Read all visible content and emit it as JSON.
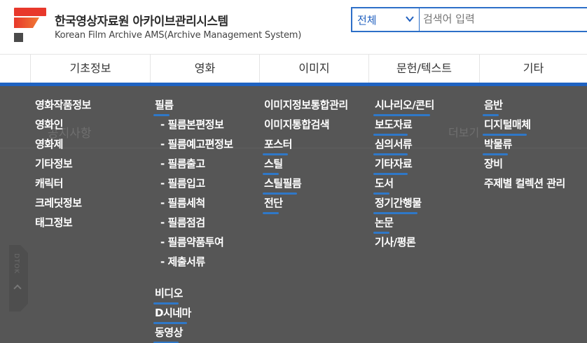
{
  "brand": {
    "title_ko": "한국영상자료원 아카이브관리시스템",
    "title_en": "Korean Film Archive AMS(Archive Management System)"
  },
  "search": {
    "scope_selected": "전체",
    "placeholder": "검색어 입력"
  },
  "nav": {
    "items": [
      {
        "label": "기초정보"
      },
      {
        "label": "영화"
      },
      {
        "label": "이미지"
      },
      {
        "label": "문헌/텍스트"
      },
      {
        "label": "기타"
      }
    ]
  },
  "background": {
    "notice": "공지사항",
    "more": "더보기",
    "side_tab": "DTOK"
  },
  "menu": {
    "basic": [
      "영화작품정보",
      "영화인",
      "영화제",
      "기타정보",
      "캐릭터",
      "크레딧정보",
      "태그정보"
    ],
    "film": {
      "film_title": "필름",
      "film_subs": [
        "- 필름본편정보",
        "- 필름예고편정보",
        "- 필름출고",
        "- 필름입고",
        "- 필름세척",
        "- 필름점검",
        "- 필름약품투여",
        "- 제출서류"
      ],
      "video": "비디오",
      "dcinema": "D시네마",
      "motion": "동영상"
    },
    "image": [
      "이미지정보통합관리",
      "이미지통합검색",
      "포스터",
      "스틸",
      "스틸필름",
      "전단"
    ],
    "text": [
      "시나리오/콘티",
      "보도자료",
      "심의서류",
      "기타자료",
      "도서",
      "정기간행물",
      "논문",
      "기사/평론"
    ],
    "etc": [
      "음반",
      "디지털매체",
      "박물류",
      "장비",
      "주제별 컬렉션 관리"
    ]
  },
  "colors": {
    "accent": "#1f63c2",
    "panel_bg": "#565656",
    "underline": "#2f78c8",
    "logo_red": "#e8382b"
  }
}
